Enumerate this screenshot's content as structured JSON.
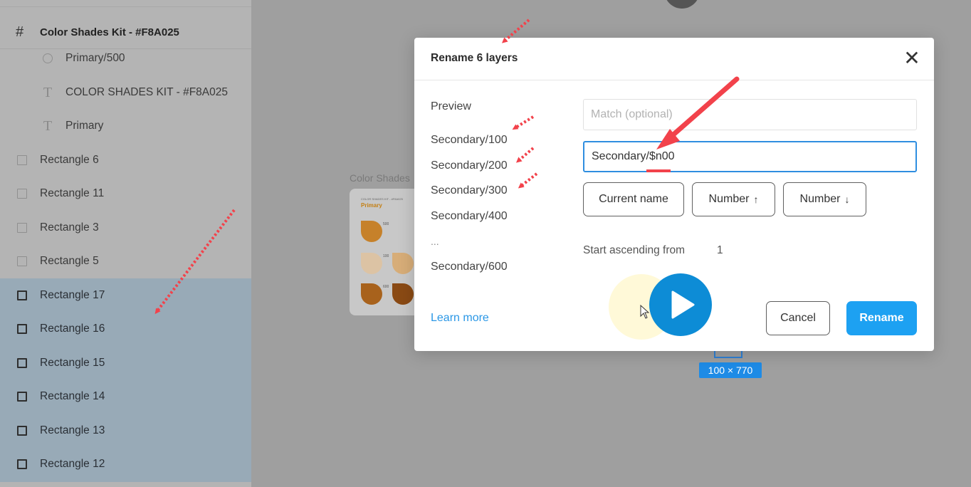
{
  "layers_panel": {
    "frame_name": "Color Shades Kit - #F8A025",
    "children": [
      {
        "icon": "ellipse-icon",
        "label": "Primary/500"
      },
      {
        "icon": "text-icon",
        "label": "COLOR SHADES KIT - #F8A025"
      },
      {
        "icon": "text-icon",
        "label": "Primary"
      }
    ],
    "rectangles": [
      {
        "label": "Rectangle 6",
        "selected": false
      },
      {
        "label": "Rectangle 11",
        "selected": false
      },
      {
        "label": "Rectangle 3",
        "selected": false
      },
      {
        "label": "Rectangle 5",
        "selected": false
      },
      {
        "label": "Rectangle 17",
        "selected": true
      },
      {
        "label": "Rectangle 16",
        "selected": true
      },
      {
        "label": "Rectangle 15",
        "selected": true
      },
      {
        "label": "Rectangle 14",
        "selected": true
      },
      {
        "label": "Rectangle 13",
        "selected": true
      },
      {
        "label": "Rectangle 12",
        "selected": true
      }
    ]
  },
  "canvas": {
    "frame_label": "Color Shades",
    "thumb_header": "COLOR SHADES KIT - #F8A025",
    "thumb_title": "Primary",
    "thumb_numbers": [
      "500",
      "100",
      "600"
    ],
    "dimension_badge": "100 × 770"
  },
  "dialog": {
    "title": "Rename 6 layers",
    "close_glyph": "✕",
    "preview_label": "Preview",
    "preview_items": [
      "Secondary/100",
      "Secondary/200",
      "Secondary/300",
      "Secondary/400"
    ],
    "preview_ellipsis": "...",
    "preview_last": "Secondary/600",
    "match_placeholder": "Match (optional)",
    "rename_value": "Secondary/$n00",
    "buttons": {
      "current_name": "Current name",
      "number_up": "Number",
      "number_up_arrow": "↑",
      "number_down": "Number",
      "number_down_arrow": "↓"
    },
    "start_label": "Start ascending from",
    "start_value": "1",
    "learn_more": "Learn more",
    "cancel": "Cancel",
    "rename": "Rename"
  },
  "colors": {
    "accent": "#1da1f2",
    "annotation": "#f2424b",
    "selection": "#98aab7",
    "play": "#0d8cd6"
  }
}
